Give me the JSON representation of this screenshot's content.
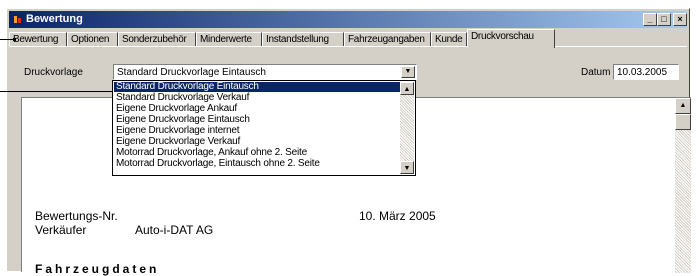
{
  "window": {
    "title": "Bewertung",
    "minimize": "_",
    "maximize": "□",
    "close": "×"
  },
  "tabs": [
    {
      "label": "Bewertung"
    },
    {
      "label": "Optionen"
    },
    {
      "label": "Sonderzubehör"
    },
    {
      "label": "Minderwerte"
    },
    {
      "label": "Instandstellung"
    },
    {
      "label": "Fahrzeugangaben"
    },
    {
      "label": "Kunde"
    },
    {
      "label": "Druckvorschau"
    }
  ],
  "form": {
    "druckvorlage_label": "Druckvorlage",
    "druckvorlage_value": "Standard Druckvorlage Eintausch",
    "datum_label": "Datum",
    "datum_value": "10.03.2005"
  },
  "dropdown": {
    "options": [
      "Standard Druckvorlage Eintausch",
      "Standard Druckvorlage Verkauf",
      "Eigene Druckvorlage Ankauf",
      "Eigene Druckvorlage Eintausch",
      "Eigene Druckvorlage internet",
      "Eigene Druckvorlage Verkauf",
      "Motorrad Druckvorlage, Ankauf ohne 2. Seite",
      "Motorrad Druckvorlage, Eintausch ohne 2. Seite"
    ],
    "selected_index": 0
  },
  "document": {
    "bewertungs_nr_label": "Bewertungs-Nr.",
    "verkaeufer_label": "Verkäufer",
    "verkaeufer_value": "Auto-i-DAT AG",
    "date_text": "10. März 2005",
    "section_heading": "Fahrzeugdaten"
  },
  "colors": {
    "title_bar": "#0a246a",
    "selection": "#0a246a",
    "face": "#d4d0c8"
  }
}
